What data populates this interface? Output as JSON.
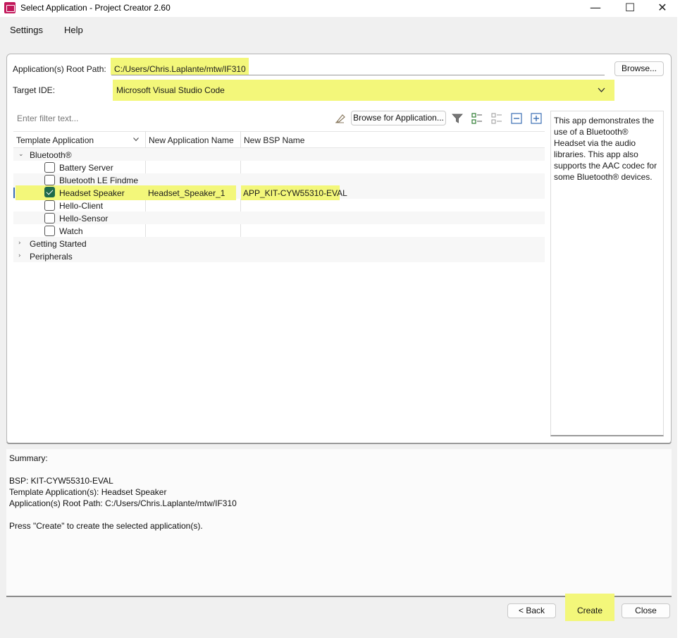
{
  "window": {
    "title": "Select Application - Project Creator 2.60"
  },
  "menu": {
    "settings": "Settings",
    "help": "Help"
  },
  "root_path": {
    "label": "Application(s) Root Path:",
    "value": "C:/Users/Chris.Laplante/mtw/IF310",
    "browse": "Browse..."
  },
  "target_ide": {
    "label": "Target IDE:",
    "value": "Microsoft Visual Studio Code"
  },
  "filter": {
    "placeholder": "Enter filter text...",
    "browse_apps": "Browse for Application..."
  },
  "table": {
    "headers": [
      "Template Application",
      "New Application Name",
      "New BSP Name"
    ],
    "groups": [
      {
        "name": "Bluetooth®",
        "expanded": true
      },
      {
        "name": "Getting Started",
        "expanded": false
      },
      {
        "name": "Peripherals",
        "expanded": false
      }
    ],
    "items": [
      {
        "name": "Battery Server",
        "checked": false
      },
      {
        "name": "Bluetooth LE Findme",
        "checked": false
      },
      {
        "name": "Headset Speaker",
        "checked": true,
        "app_name": "Headset_Speaker_1",
        "bsp_name": "APP_KIT-CYW55310-EVAL"
      },
      {
        "name": "Hello-Client",
        "checked": false
      },
      {
        "name": "Hello-Sensor",
        "checked": false
      },
      {
        "name": "Watch",
        "checked": false
      }
    ]
  },
  "description": "This app demonstrates the use of a Bluetooth® Headset via the audio libraries. This app also supports the AAC codec for some Bluetooth® devices.",
  "summary": {
    "heading": "Summary:",
    "bsp": "BSP: KIT-CYW55310-EVAL",
    "template": "Template Application(s): Headset Speaker",
    "root": "Application(s) Root Path: C:/Users/Chris.Laplante/mtw/IF310",
    "hint": "Press \"Create\" to create the selected application(s)."
  },
  "buttons": {
    "back": "< Back",
    "create": "Create",
    "close": "Close"
  },
  "colors": {
    "highlight": "#f3f77a",
    "check_green": "#1f6b4a",
    "app_icon": "#c2185b"
  }
}
